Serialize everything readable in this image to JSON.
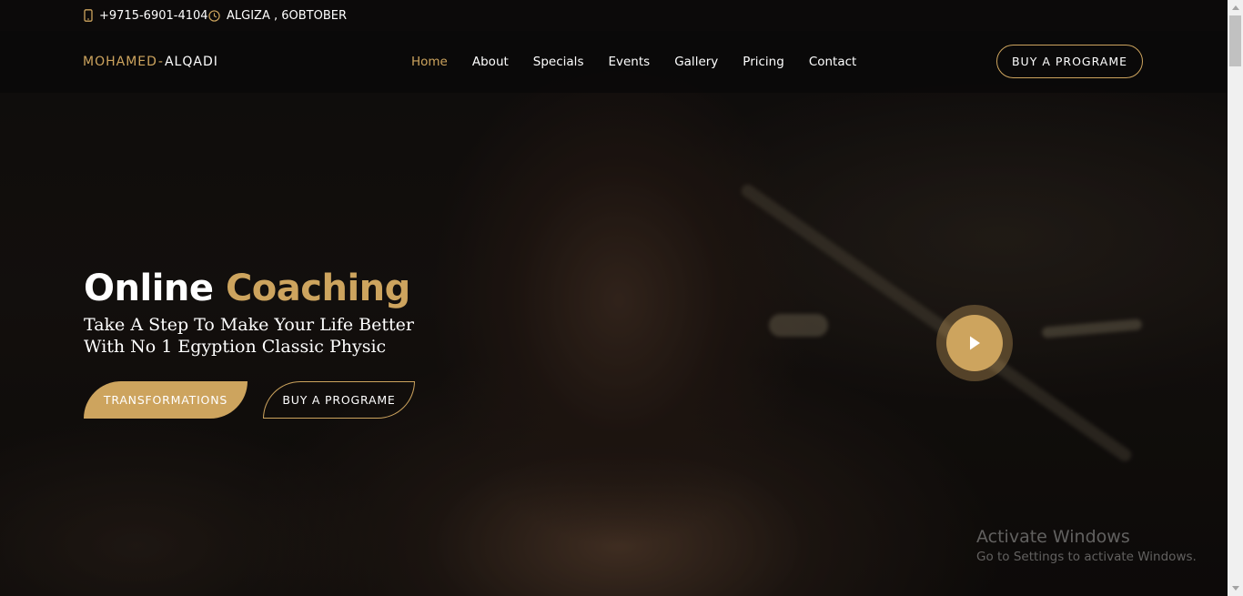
{
  "topbar": {
    "phone": "+9715-6901-4104",
    "phone_icon": "phone-icon",
    "location": "ALGIZA , 6OBTOBER",
    "location_icon": "clock-icon"
  },
  "header": {
    "logo_part1": "MOHAMED",
    "logo_sep": "-",
    "logo_part2": "ALQADI",
    "nav": [
      {
        "label": "Home",
        "active": true
      },
      {
        "label": "About"
      },
      {
        "label": "Specials"
      },
      {
        "label": "Events"
      },
      {
        "label": "Gallery"
      },
      {
        "label": "Pricing"
      },
      {
        "label": "Contact"
      }
    ],
    "cta_label": "BUY A PROGRAME"
  },
  "hero": {
    "title_word1": "Online",
    "title_word2": "Coaching",
    "subtitle_line1": "Take A Step To Make Your Life Better",
    "subtitle_line2": "With No 1 Egyption Classic Physic",
    "btn_transformations": "TRANSFORMATIONS",
    "btn_buy": "BUY A PROGRAME",
    "play_icon": "play-icon"
  },
  "watermark": {
    "title": "Activate Windows",
    "subtitle": "Go to Settings to activate Windows."
  },
  "colors": {
    "accent": "#cda45e",
    "background": "#0b0908",
    "text": "#ffffff"
  }
}
